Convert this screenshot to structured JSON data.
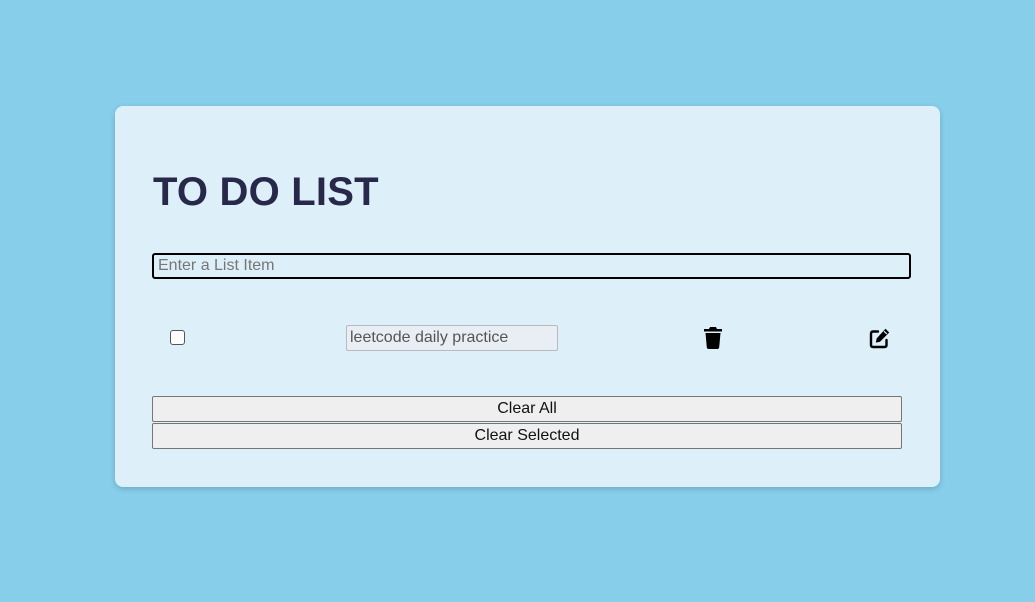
{
  "app": {
    "title": "TO DO LIST"
  },
  "new_item": {
    "placeholder": "Enter a List Item",
    "value": ""
  },
  "todos": [
    {
      "text": "leetcode daily practice",
      "checked": false,
      "delete_icon": "trash-icon",
      "edit_icon": "edit-icon"
    }
  ],
  "actions": {
    "clear_all_label": "Clear All",
    "clear_selected_label": "Clear Selected"
  },
  "colors": {
    "page_background": "#87ceeb",
    "card_background": "#ddf0f9",
    "title": "#27284a"
  }
}
